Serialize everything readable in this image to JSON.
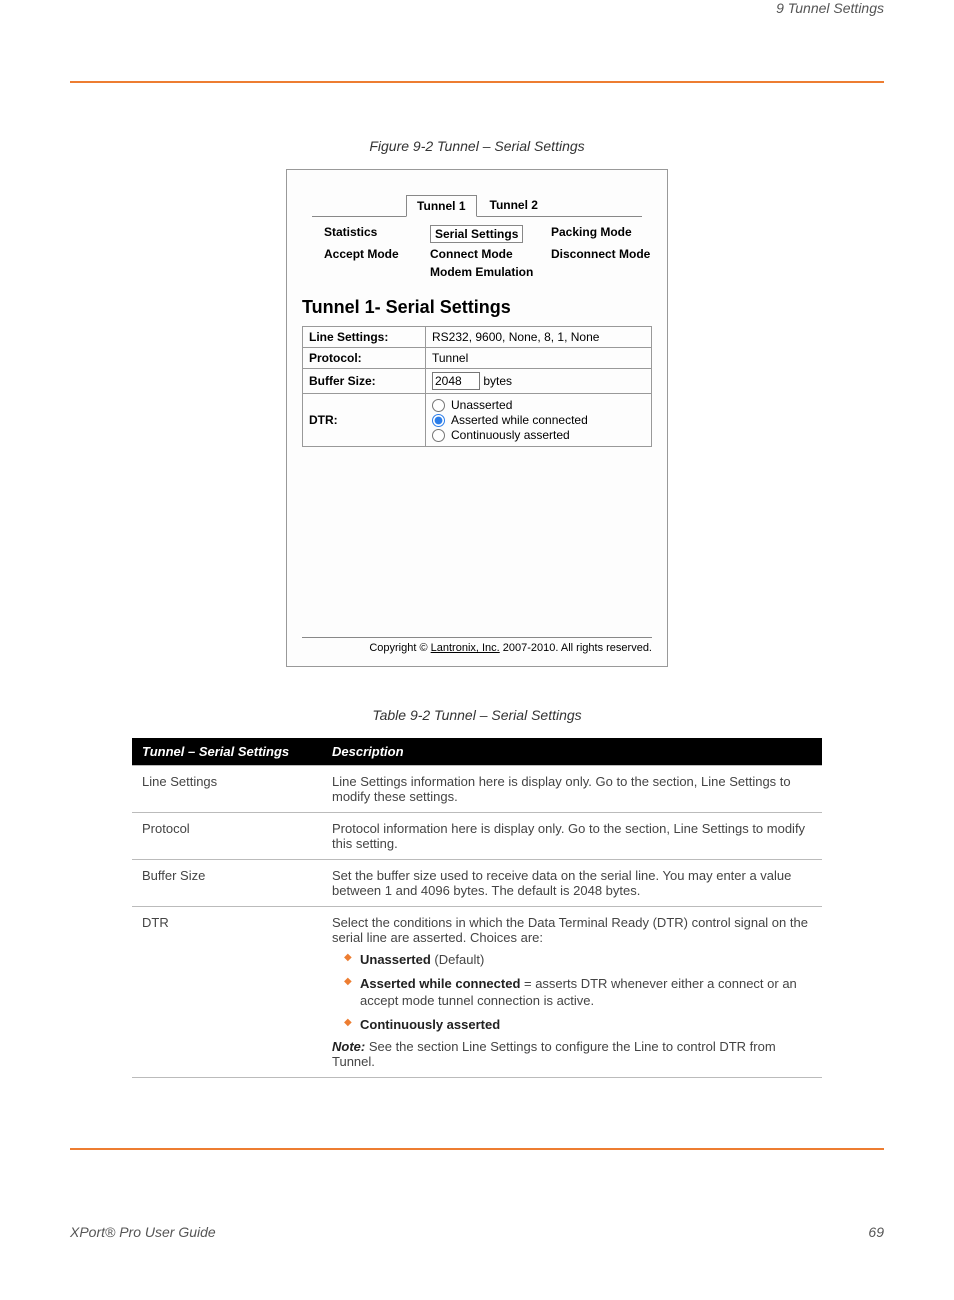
{
  "header": {
    "left": "",
    "right": "9  Tunnel Settings"
  },
  "caption_figure": "Figure 9-2  Tunnel – Serial Settings",
  "panel": {
    "tabs": [
      "Tunnel 1",
      "Tunnel 2"
    ],
    "modes": {
      "r1c1": "Statistics",
      "r1c2": "Serial Settings",
      "r1c3": "Packing Mode",
      "r2c1": "Accept Mode",
      "r2c2": "Connect Mode",
      "r2c3": "Disconnect Mode",
      "r3c2": "Modem Emulation"
    },
    "title": "Tunnel 1- Serial Settings",
    "rows": {
      "line_settings_label": "Line Settings:",
      "line_settings_value": "RS232, 9600, None, 8, 1, None",
      "protocol_label": "Protocol:",
      "protocol_value": "Tunnel",
      "buffer_label": "Buffer Size:",
      "buffer_value": "2048",
      "buffer_unit": "bytes",
      "dtr_label": "DTR:",
      "dtr_options": {
        "o1": "Unasserted",
        "o2": "Asserted while connected",
        "o3": "Continuously asserted"
      }
    },
    "copyright_pre": "Copyright © ",
    "copyright_link": "Lantronix, Inc.",
    "copyright_post": " 2007-2010. All rights reserved."
  },
  "caption_table": "Table 9-2  Tunnel – Serial Settings",
  "desc_table": {
    "head_col1": "Tunnel – Serial Settings",
    "head_col2": "Description",
    "rows": [
      {
        "label": "Line Settings",
        "desc": "Line Settings information here is display only. Go to the section, Line Settings to modify these settings."
      },
      {
        "label": "Protocol",
        "desc": "Protocol information here is display only. Go to the section, Line Settings to modify this setting."
      },
      {
        "label": "Buffer Size",
        "desc": "Set the buffer size used to receive data on the serial line. You may enter a value between 1 and 4096 bytes. The default is 2048 bytes."
      },
      {
        "label": "DTR",
        "desc_intro": "Select the conditions in which the Data Terminal Ready (DTR) control signal on the serial line are asserted. Choices are:",
        "bullets": [
          {
            "b": "Unasserted",
            "rest": " (Default)"
          },
          {
            "b": "Asserted while connected",
            "rest": " = asserts DTR whenever either a connect or an accept mode tunnel connection is active."
          },
          {
            "b": "Continuously asserted"
          }
        ],
        "note_b": "Note:",
        "note_rest": " See the section Line Settings to configure the Line to control DTR from Tunnel."
      }
    ]
  },
  "footer": {
    "left": "XPort® Pro User Guide",
    "right": "69"
  }
}
